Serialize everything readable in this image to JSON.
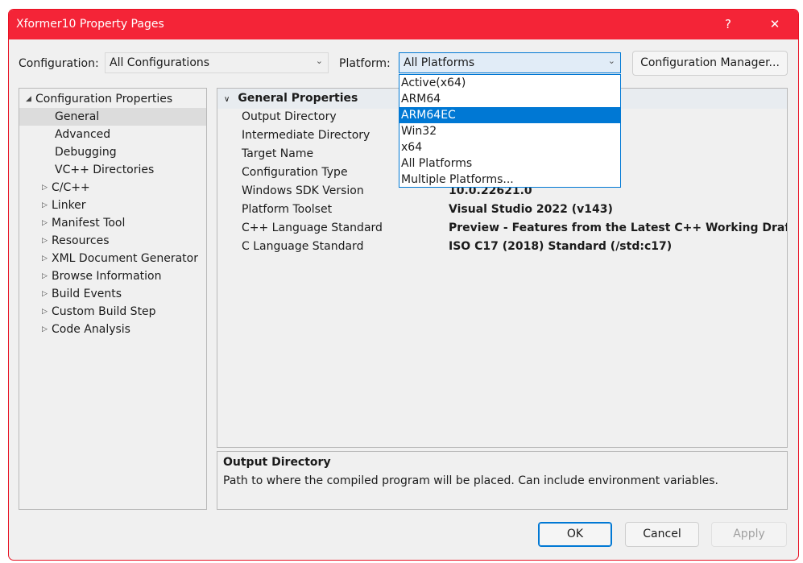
{
  "window": {
    "title": "Xformer10 Property Pages",
    "help_label": "?",
    "close_label": "✕"
  },
  "toolbar": {
    "configuration_label": "Configuration:",
    "configuration_value": "All Configurations",
    "platform_label": "Platform:",
    "platform_value": "All Platforms",
    "config_manager_label": "Configuration Manager...",
    "chevron": "⌄"
  },
  "platform_dropdown": {
    "options": [
      "Active(x64)",
      "ARM64",
      "ARM64EC",
      "Win32",
      "x64",
      "All Platforms",
      "Multiple Platforms..."
    ],
    "highlighted": "ARM64EC"
  },
  "tree": {
    "root": "Configuration Properties",
    "items": [
      "General",
      "Advanced",
      "Debugging",
      "VC++ Directories",
      "C/C++",
      "Linker",
      "Manifest Tool",
      "Resources",
      "XML Document Generator",
      "Browse Information",
      "Build Events",
      "Custom Build Step",
      "Code Analysis"
    ],
    "selected": "General"
  },
  "properties": {
    "section": "General Properties",
    "rows": [
      {
        "name": "Output Directory",
        "value": ""
      },
      {
        "name": "Intermediate Directory",
        "value": ""
      },
      {
        "name": "Target Name",
        "value": ""
      },
      {
        "name": "Configuration Type",
        "value": ""
      },
      {
        "name": "Windows SDK Version",
        "value": "10.0.22621.0"
      },
      {
        "name": "Platform Toolset",
        "value": "Visual Studio 2022 (v143)"
      },
      {
        "name": "C++ Language Standard",
        "value": "Preview - Features from the Latest C++ Working Draft (/std"
      },
      {
        "name": "C Language Standard",
        "value": "ISO C17 (2018) Standard (/std:c17)"
      }
    ]
  },
  "description": {
    "title": "Output Directory",
    "text": "Path to where the compiled program will be placed. Can include environment variables."
  },
  "buttons": {
    "ok": "OK",
    "cancel": "Cancel",
    "apply": "Apply"
  }
}
